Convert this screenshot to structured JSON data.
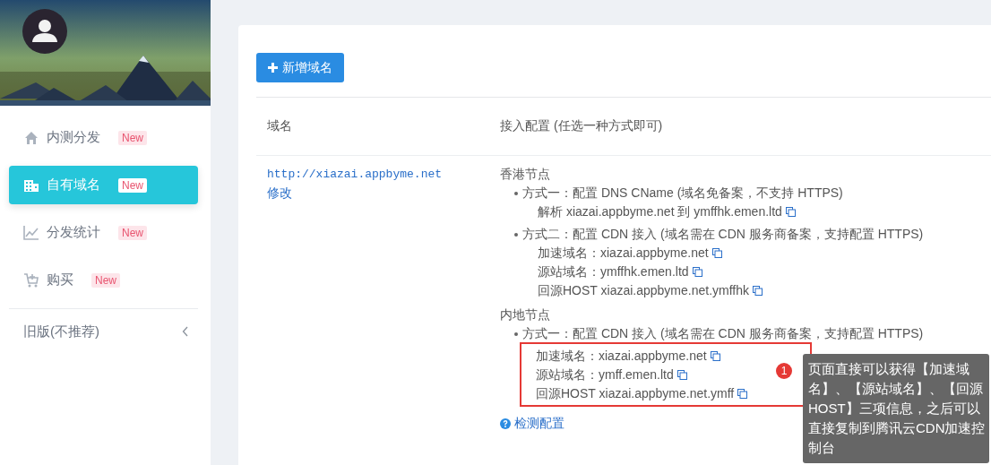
{
  "sidebar": {
    "items": [
      {
        "kind": "home",
        "label": "内测分发",
        "badge": "New",
        "selected": false
      },
      {
        "kind": "building",
        "label": "自有域名",
        "badge": "New",
        "selected": true
      },
      {
        "kind": "chart",
        "label": "分发统计",
        "badge": "New",
        "selected": false
      },
      {
        "kind": "cart",
        "label": "购买",
        "badge": "New",
        "selected": false
      }
    ],
    "legacy": {
      "label": "旧版(不推荐)",
      "expanded": false
    }
  },
  "toolbar": {
    "add_button": "新增域名"
  },
  "table": {
    "columns": [
      "域名",
      "接入配置 (任选一种方式即可)"
    ],
    "rows": [
      {
        "domain": "http://xiazai.appbyme.net",
        "edit_link": "修改",
        "sections": [
          {
            "title": "香港节点",
            "methods": [
              {
                "label": "方式一：配置 DNS CName (域名免备案，不支持 HTTPS)",
                "highlighted": false,
                "lines": [
                  "解析 xiazai.appbyme.net 到 ymffhk.emen.ltd"
                ]
              },
              {
                "label": "方式二：配置 CDN 接入 (域名需在 CDN 服务商备案，支持配置 HTTPS)",
                "highlighted": false,
                "lines": [
                  "加速域名：xiazai.appbyme.net",
                  "源站域名：ymffhk.emen.ltd",
                  "回源HOST xiazai.appbyme.net.ymffhk"
                ]
              }
            ]
          },
          {
            "title": "内地节点",
            "methods": [
              {
                "label": "方式一：配置 CDN 接入 (域名需在 CDN 服务商备案，支持配置 HTTPS)",
                "highlighted": true,
                "lines": [
                  "加速域名：xiazai.appbyme.net",
                  "源站域名：ymff.emen.ltd",
                  "回源HOST xiazai.appbyme.net.ymff"
                ]
              }
            ]
          }
        ],
        "check_link": "检测配置"
      }
    ]
  },
  "annotation": {
    "number": "1",
    "text": "页面直接可以获得【加速域名】、【源站域名】、【回源HOST】三项信息，之后可以直接复制到腾讯云CDN加速控制台"
  }
}
